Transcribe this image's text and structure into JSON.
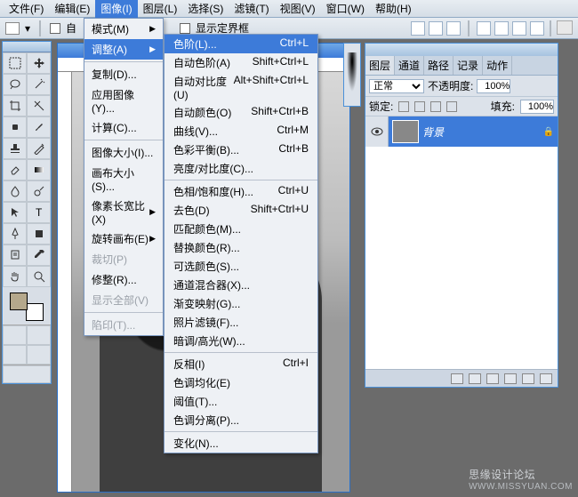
{
  "menubar": {
    "items": [
      "文件(F)",
      "编辑(E)",
      "图像(I)",
      "图层(L)",
      "选择(S)",
      "滤镜(T)",
      "视图(V)",
      "窗口(W)",
      "帮助(H)"
    ],
    "active_index": 2
  },
  "optionsbar": {
    "auto_label": "自",
    "transform_label": "显示定界框"
  },
  "image_menu": {
    "items": [
      {
        "label": "模式(M)",
        "arrow": true
      },
      {
        "label": "调整(A)",
        "arrow": true,
        "hover": true
      },
      {
        "sep": true
      },
      {
        "label": "复制(D)..."
      },
      {
        "label": "应用图像(Y)..."
      },
      {
        "label": "计算(C)..."
      },
      {
        "sep": true
      },
      {
        "label": "图像大小(I)..."
      },
      {
        "label": "画布大小(S)..."
      },
      {
        "label": "像素长宽比(X)",
        "arrow": true
      },
      {
        "label": "旋转画布(E)",
        "arrow": true
      },
      {
        "label": "裁切(P)",
        "disabled": true
      },
      {
        "label": "修整(R)..."
      },
      {
        "label": "显示全部(V)",
        "disabled": true
      },
      {
        "sep": true
      },
      {
        "label": "陷印(T)...",
        "disabled": true
      }
    ]
  },
  "adjust_menu": {
    "items": [
      {
        "label": "色阶(L)...",
        "shortcut": "Ctrl+L",
        "hover": true
      },
      {
        "label": "自动色阶(A)",
        "shortcut": "Shift+Ctrl+L"
      },
      {
        "label": "自动对比度(U)",
        "shortcut": "Alt+Shift+Ctrl+L"
      },
      {
        "label": "自动颜色(O)",
        "shortcut": "Shift+Ctrl+B"
      },
      {
        "label": "曲线(V)...",
        "shortcut": "Ctrl+M"
      },
      {
        "label": "色彩平衡(B)...",
        "shortcut": "Ctrl+B"
      },
      {
        "label": "亮度/对比度(C)..."
      },
      {
        "sep": true
      },
      {
        "label": "色相/饱和度(H)...",
        "shortcut": "Ctrl+U"
      },
      {
        "label": "去色(D)",
        "shortcut": "Shift+Ctrl+U"
      },
      {
        "label": "匹配颜色(M)..."
      },
      {
        "label": "替换颜色(R)..."
      },
      {
        "label": "可选颜色(S)..."
      },
      {
        "label": "通道混合器(X)..."
      },
      {
        "label": "渐变映射(G)..."
      },
      {
        "label": "照片滤镜(F)..."
      },
      {
        "label": "暗调/高光(W)..."
      },
      {
        "sep": true
      },
      {
        "label": "反相(I)",
        "shortcut": "Ctrl+I"
      },
      {
        "label": "色调均化(E)"
      },
      {
        "label": "阈值(T)..."
      },
      {
        "label": "色调分离(P)..."
      },
      {
        "sep": true
      },
      {
        "label": "变化(N)..."
      }
    ]
  },
  "layers_panel": {
    "tabs": [
      "图层",
      "通道",
      "路径",
      "记录",
      "动作"
    ],
    "active_tab": 0,
    "blend_mode": "正常",
    "opacity_label": "不透明度:",
    "opacity_value": "100%",
    "lock_label": "锁定:",
    "fill_label": "填充:",
    "fill_value": "100%",
    "layer_name": "背景"
  },
  "watermark": {
    "line1": "思缘设计论坛",
    "line2": "WWW.MISSYUAN.COM"
  }
}
